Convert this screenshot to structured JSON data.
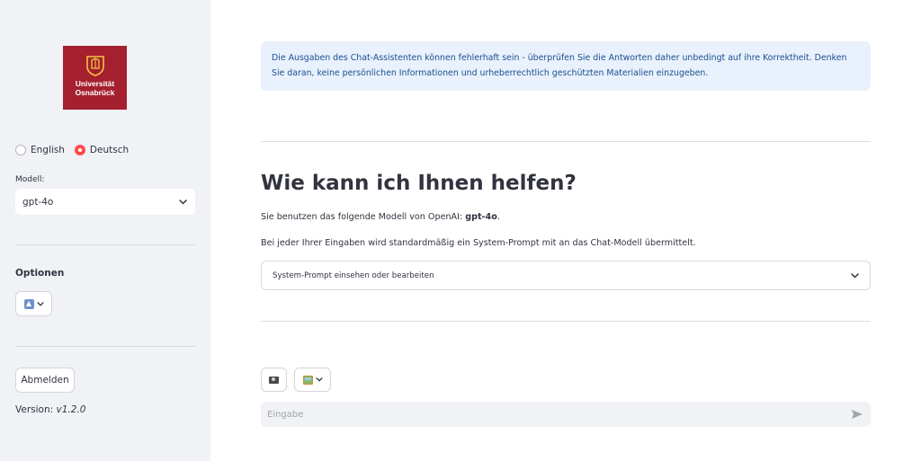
{
  "sidebar": {
    "logo": {
      "line1": "Universität",
      "line2": "Osnabrück",
      "color": "#a5202e"
    },
    "language": {
      "options": [
        {
          "label": "English",
          "selected": false
        },
        {
          "label": "Deutsch",
          "selected": true
        }
      ]
    },
    "model_label": "Modell:",
    "model_value": "gpt-4o",
    "options_title": "Optionen",
    "logout_label": "Abmelden",
    "version_prefix": "Version: ",
    "version_value": "v1.2.0"
  },
  "main": {
    "info_text": "Die Ausgaben des Chat-Assistenten können fehlerhaft sein - überprüfen Sie die Antworten daher unbedingt auf ihre Korrektheit. Denken Sie daran, keine persönlichen Informationen und urheberrechtlich geschützten Materialien einzugeben.",
    "heading": "Wie kann ich Ihnen helfen?",
    "model_sentence_prefix": "Sie benutzen das folgende Modell von OpenAI: ",
    "model_sentence_model": "gpt-4o",
    "model_sentence_suffix": ".",
    "system_prompt_sentence": "Bei jeder Ihrer Eingaben wird standardmäßig ein System-Prompt mit an das Chat-Modell übermittelt.",
    "expander_label": "System-Prompt einsehen oder bearbeiten",
    "chat_input": {
      "placeholder": "Eingabe",
      "value": ""
    }
  },
  "colors": {
    "accent": "#ff4b4b",
    "info_bg": "#e8f1fc",
    "info_text": "#1d4f91",
    "sidebar_bg": "#f0f2f6"
  },
  "icons": [
    "university-logo",
    "chevron-down-icon",
    "upload-icon",
    "camera-icon",
    "image-icon",
    "send-icon"
  ]
}
